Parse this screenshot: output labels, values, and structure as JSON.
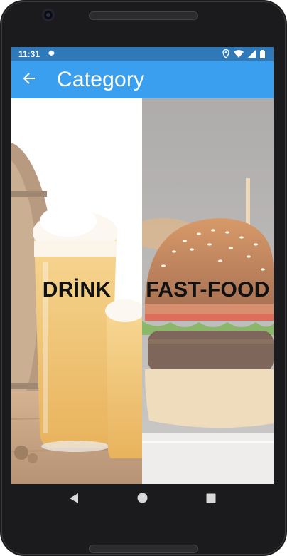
{
  "status_bar": {
    "time": "11:31",
    "icons": [
      "gear-icon",
      "location-icon",
      "wifi-icon",
      "signal-icon",
      "battery-icon"
    ]
  },
  "app_bar": {
    "title": "Category",
    "back_icon": "arrow-left-icon",
    "color": "#3b9ff0"
  },
  "categories": [
    {
      "label": "DRİNK",
      "image": "beer-glasses-photo"
    },
    {
      "label": "FAST-FOOD",
      "image": "burger-photo"
    }
  ],
  "nav_bar": {
    "buttons": [
      "back-triangle-icon",
      "home-circle-icon",
      "recents-square-icon"
    ]
  }
}
